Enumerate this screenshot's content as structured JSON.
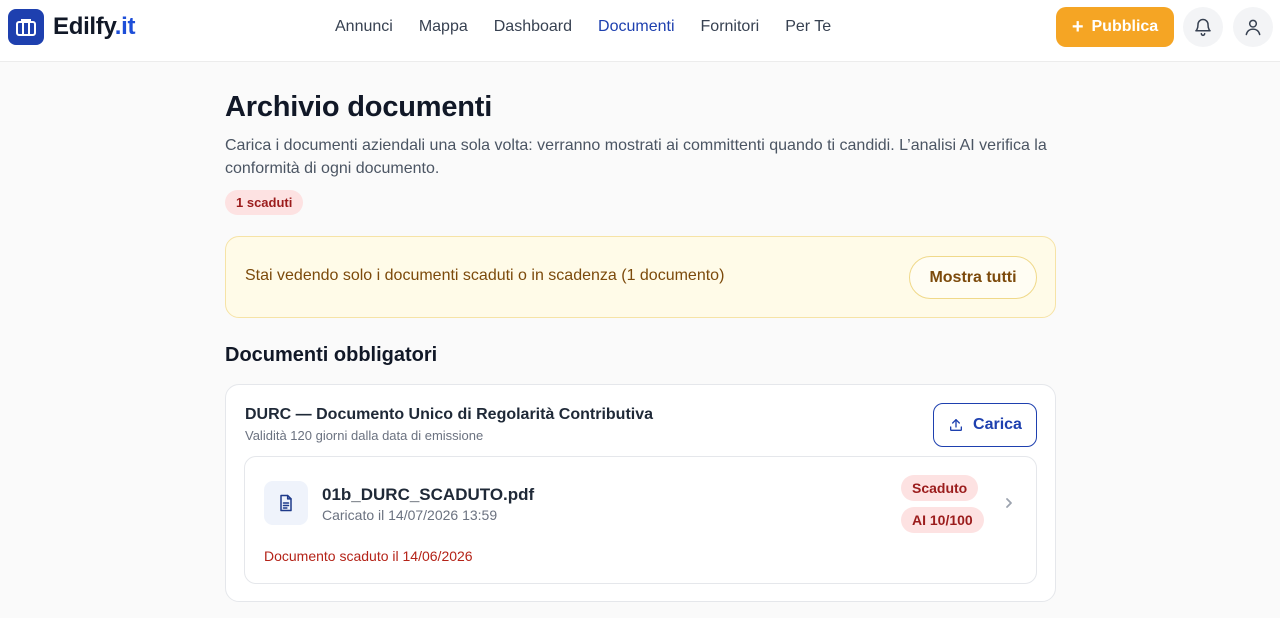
{
  "header": {
    "brand_name": "Edilfy",
    "brand_tld": ".it",
    "nav": [
      {
        "label": "Annunci",
        "active": false
      },
      {
        "label": "Mappa",
        "active": false
      },
      {
        "label": "Dashboard",
        "active": false
      },
      {
        "label": "Documenti",
        "active": true
      },
      {
        "label": "Fornitori",
        "active": false
      },
      {
        "label": "Per Te",
        "active": false
      }
    ],
    "publish_label": "Pubblica",
    "icons": [
      "building-logo-icon",
      "plus-icon",
      "bell-icon",
      "user-icon"
    ]
  },
  "page": {
    "title": "Archivio documenti",
    "subtitle": "Carica i documenti aziendali una sola volta: verranno mostrati ai committenti quando ti candidi. L’analisi AI verifica la conformità di ogni documento.",
    "expired_badge": "1 scaduti"
  },
  "filter": {
    "text": "Stai vedendo solo i documenti scaduti o in scadenza (1 documento)",
    "show_all_label": "Mostra tutti"
  },
  "section": {
    "title": "Documenti obbligatori",
    "document_type": {
      "title": "DURC — Documento Unico di Regolarità Contributiva",
      "subtitle": "Validità 120 giorni dalla data di emissione",
      "upload_label": "Carica"
    },
    "file": {
      "name": "01b_DURC_SCADUTO.pdf",
      "uploaded": "Caricato il 14/07/2026 13:59",
      "status_badge": "Scaduto",
      "ai_badge": "AI 10/100",
      "warning": "Documento scaduto il 14/06/2026"
    }
  },
  "colors": {
    "brand": "#1e40af",
    "publish": "#f5a524",
    "danger_bg": "#fde2e2",
    "danger_text": "#9b1c1c",
    "warning_bg": "#fffbe8"
  }
}
